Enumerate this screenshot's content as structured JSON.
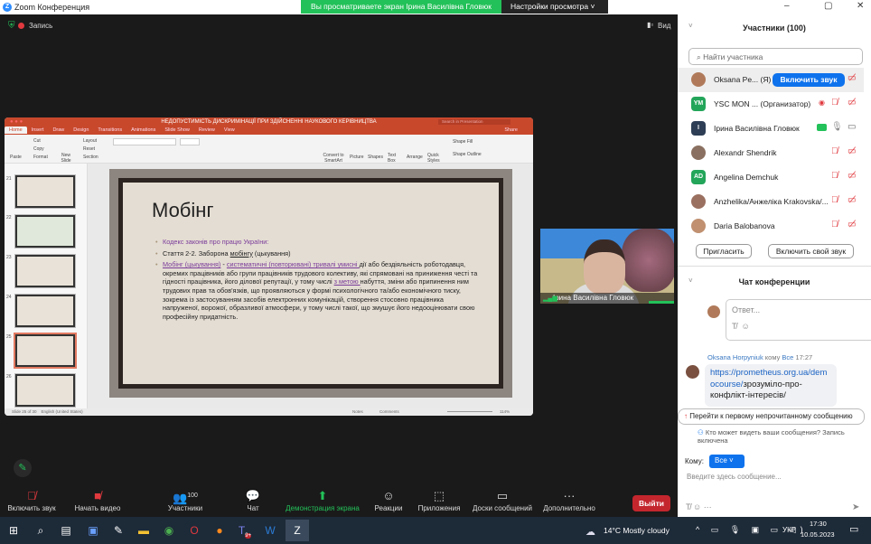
{
  "window": {
    "title": "Zoom Конференция",
    "banner": "Вы просматриваете экран Ірина Василівна Гловюк",
    "view_settings": "Настройки просмотра ˅",
    "minimize": "–",
    "maximize": "▢",
    "close": "✕"
  },
  "topbar": {
    "record": "Запись",
    "view": "Вид"
  },
  "ppt": {
    "title": "НЕДОПУСТИМІСТЬ ДИСКРИМІНАЦІЇ ПРИ ЗДІЙСНЕННІ НАУКОВОГО КЕРІВНИЦТВА",
    "search": "Search in Presentation",
    "share": "Share",
    "tabs": [
      "Home",
      "Insert",
      "Draw",
      "Design",
      "Transitions",
      "Animations",
      "Slide Show",
      "Review",
      "View"
    ],
    "ribbon": {
      "paste": "Paste",
      "cut": "Cut",
      "copy": "Copy",
      "format": "Format",
      "new_slide": "New Slide",
      "layout": "Layout",
      "reset": "Reset",
      "section": "Section",
      "convert": "Convert to SmartArt",
      "picture": "Picture",
      "shapes": "Shapes",
      "textbox": "Text Box",
      "arrange": "Arrange",
      "quick_styles": "Quick Styles",
      "shape_fill": "Shape Fill",
      "shape_outline": "Shape Outline"
    },
    "thumbs": [
      "21",
      "22",
      "23",
      "24",
      "25",
      "26"
    ],
    "status": {
      "slide": "Slide 25 of 30",
      "lang": "English (United States)",
      "notes": "Notes",
      "comments": "Comments",
      "zoom": "114%"
    }
  },
  "slide": {
    "title": "Мобінг",
    "b1": "Кодекс законів про працю України:",
    "b2a": "Стаття 2-2. Заборона ",
    "b2b": "мобінгу",
    "b2c": " (цькування)",
    "b3a": "Мобінг (цькування)",
    "b3b": " - ",
    "b3c": "систематичні (повторювані) тривалі умисні ",
    "b3d": "дії або бездіяльність роботодавця, окремих працівників або групи працівників трудового колективу, які спрямовані на приниження честі та гідності працівника, його ділової репутації, у тому числі ",
    "b3e": "з метою ",
    "b3f": "набуття, зміни або припинення ним трудових прав та обов'язків, що проявляються у формі психологічного та/або економічного тиску, зокрема із застосуванням засобів електронних комунікацій, створення стосовно працівника напруженої, ворожої, образливої атмосфери, у тому числі такої, що змушує його недооцінювати свою професійну придатність."
  },
  "video": {
    "name": "Ірина Василівна Гловюк"
  },
  "toolbar": {
    "audio": "Включить звук",
    "video": "Начать видео",
    "participants": "Участники",
    "participants_count": "100",
    "chat": "Чат",
    "share": "Демонстрация экрана",
    "reactions": "Реакции",
    "apps": "Приложения",
    "whiteboards": "Доски сообщений",
    "more": "Дополнительно",
    "leave": "Выйти"
  },
  "participants": {
    "header": "Участники (100)",
    "search_placeholder": "Найти участника",
    "unmute_btn": "Включить звук",
    "rows": [
      {
        "name": "Oksana Pe... (Я)",
        "initials": "",
        "color": "#b07a5a"
      },
      {
        "name": "YSC MON ... (Организатор)",
        "initials": "YM",
        "color": "#23a55a"
      },
      {
        "name": "Ірина Василівна Гловюк",
        "initials": "I",
        "color": "#2d3e55"
      },
      {
        "name": "Alexandr Shendrik",
        "initials": "",
        "color": "#8a7060"
      },
      {
        "name": "Angelina Demchuk",
        "initials": "AD",
        "color": "#23a55a"
      },
      {
        "name": "Anzhelika/Анжеліка Krakovska/...",
        "initials": "",
        "color": "#9a7060"
      },
      {
        "name": "Daria Balobanova",
        "initials": "",
        "color": "#c09070"
      }
    ],
    "invite": "Пригласить",
    "unmute_me": "Включить свой звук"
  },
  "chat": {
    "header": "Чат конференции",
    "reply_placeholder": "Ответ...",
    "sender": "Oksana Horpyniuk",
    "to_word": "кому",
    "to": "Все",
    "time": "17:27",
    "link": "https://prometheus.org.ua/democourse/",
    "msg_rest": "зрозуміло-про-конфлікт-інтересів/",
    "unread": "Перейти к первому непрочитанному сообщению",
    "who_sees": "Кто может видеть ваши сообщения? Запись включена",
    "to_label": "Кому:",
    "to_value": "Все",
    "input_placeholder": "Введите здесь сообщение..."
  },
  "taskbar": {
    "weather": "14°C  Mostly cloudy",
    "lang": "УКР",
    "time": "17:30",
    "date": "10.05.2023",
    "teams_badge": "9+"
  }
}
